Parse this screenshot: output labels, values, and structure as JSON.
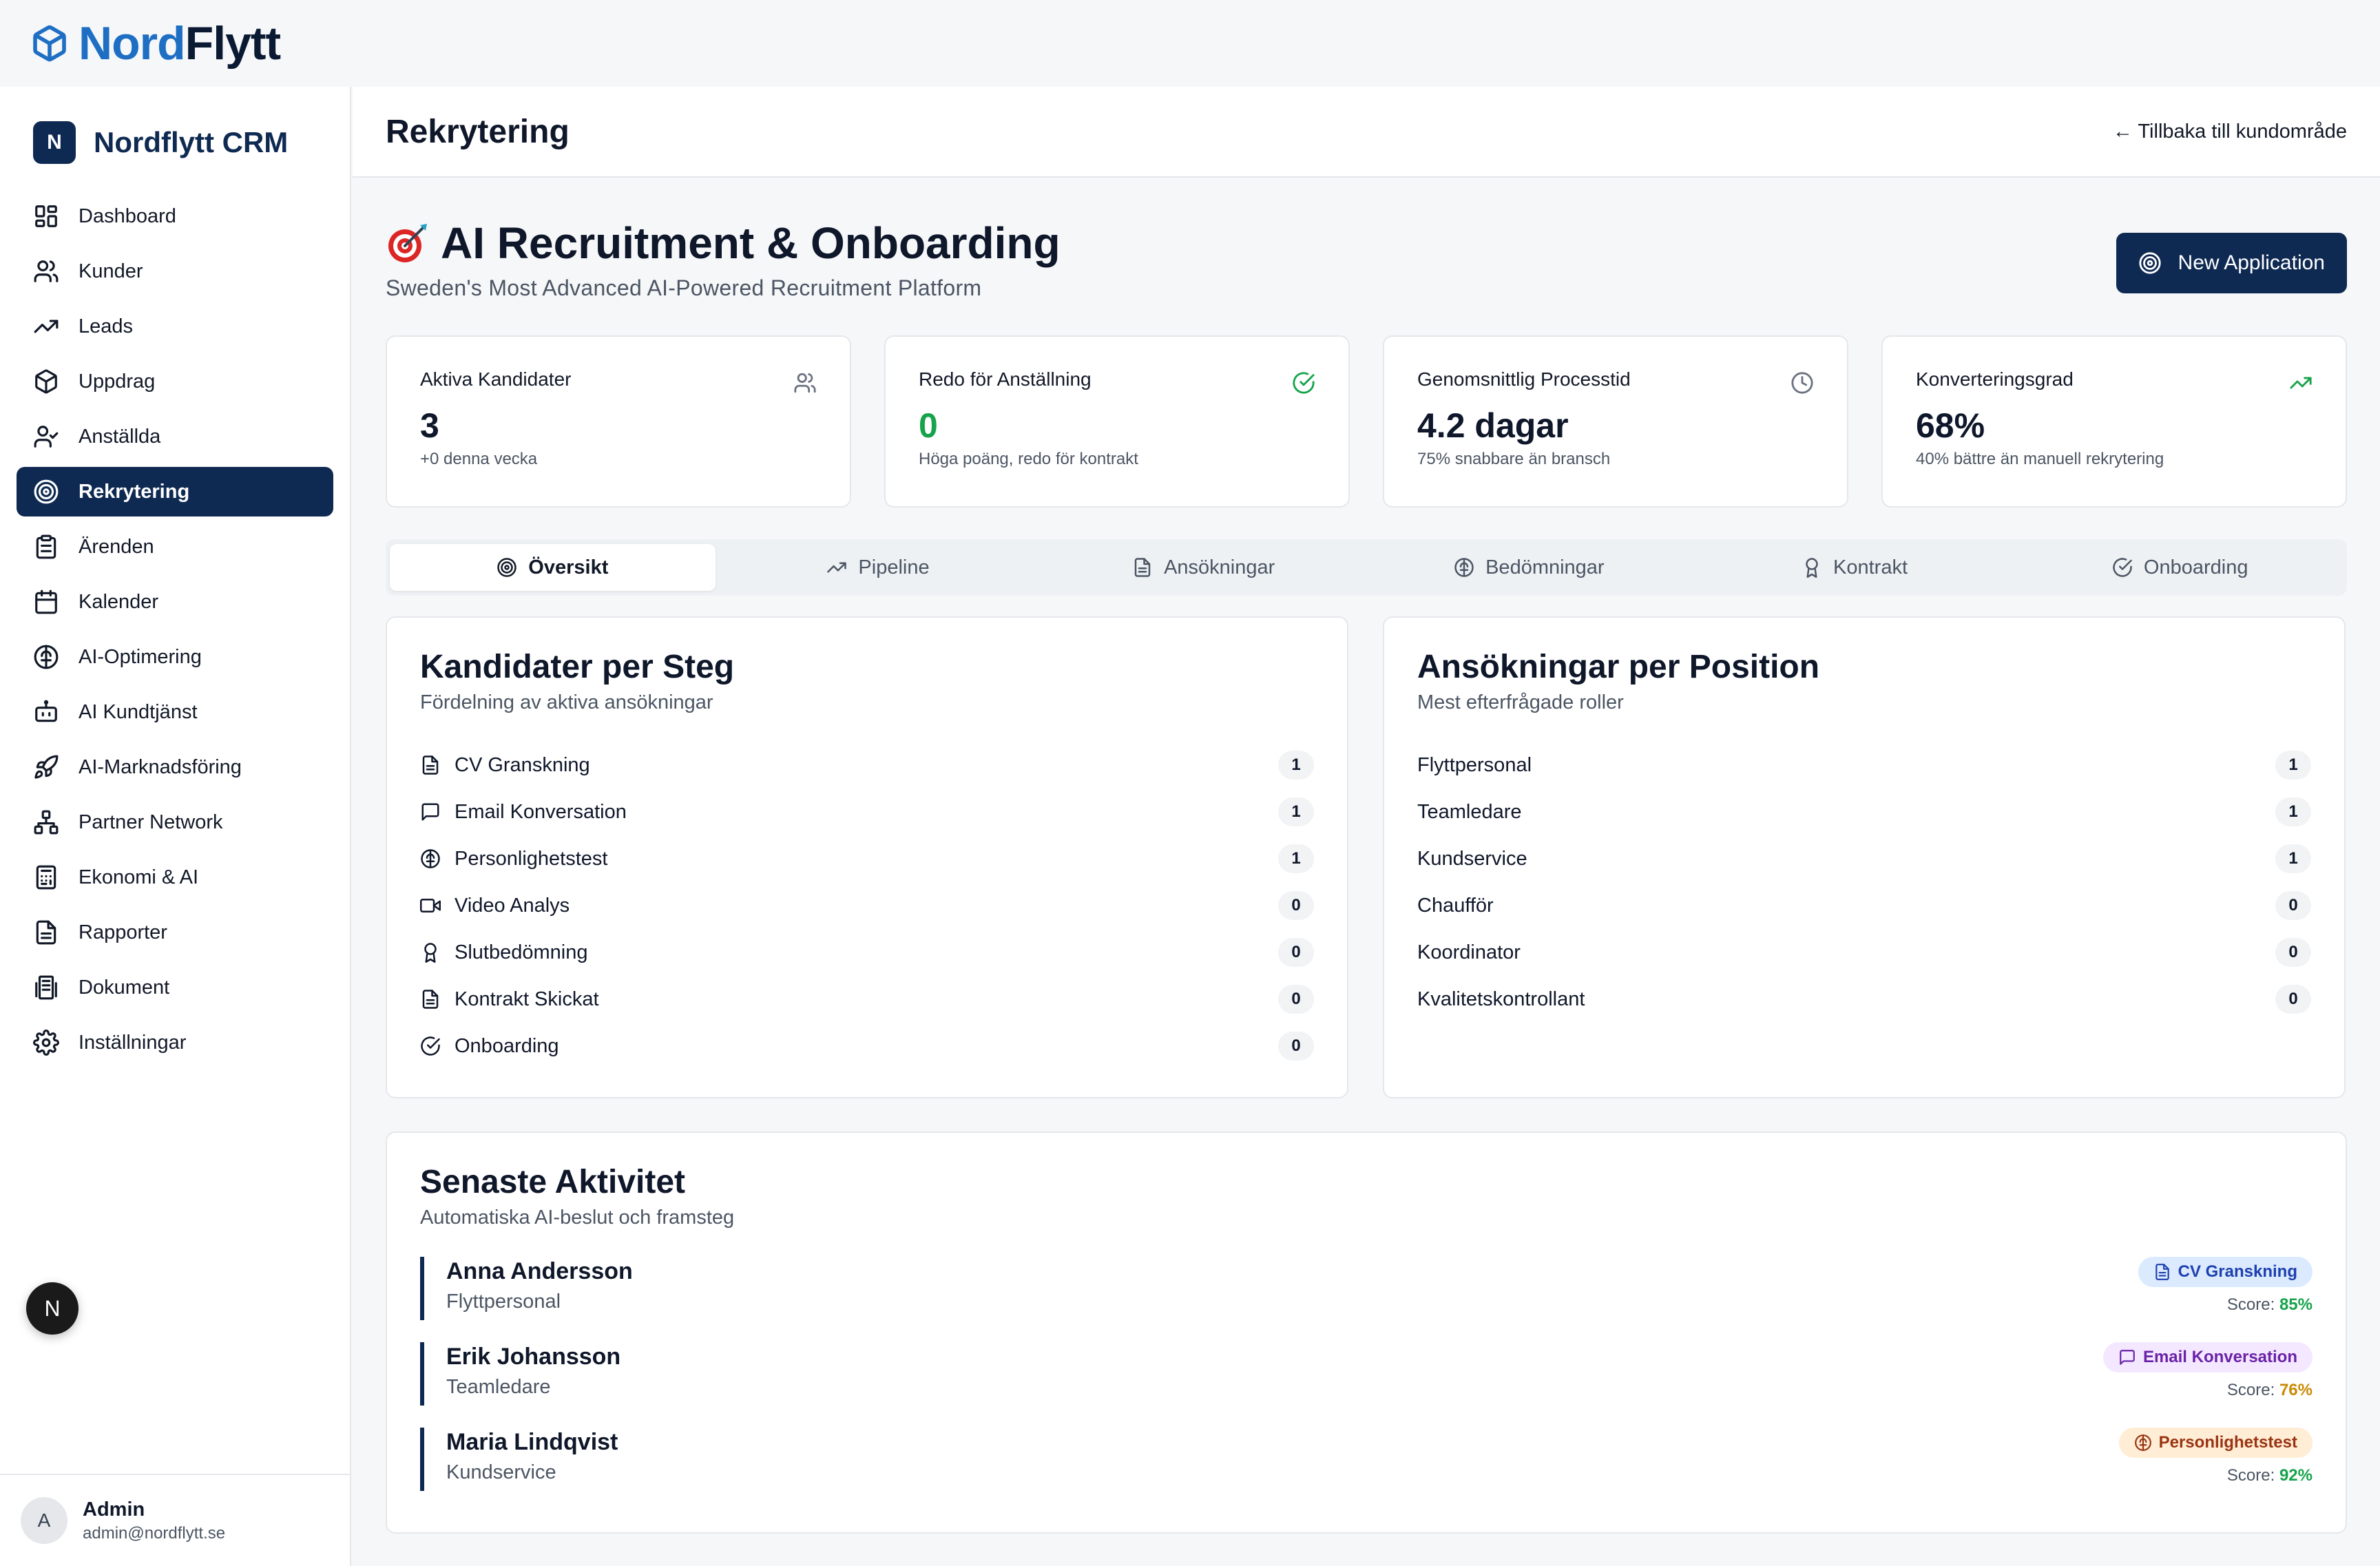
{
  "brand": {
    "part1": "Nord",
    "part2": "Flytt"
  },
  "sidebar": {
    "logo_letter": "N",
    "title": "Nordflytt CRM",
    "items": [
      {
        "label": "Dashboard",
        "icon": "dashboard-icon"
      },
      {
        "label": "Kunder",
        "icon": "users-icon"
      },
      {
        "label": "Leads",
        "icon": "trending-up-icon"
      },
      {
        "label": "Uppdrag",
        "icon": "package-icon"
      },
      {
        "label": "Anställda",
        "icon": "user-check-icon"
      },
      {
        "label": "Rekrytering",
        "icon": "target-icon",
        "active": true
      },
      {
        "label": "Ärenden",
        "icon": "clipboard-icon"
      },
      {
        "label": "Kalender",
        "icon": "calendar-icon"
      },
      {
        "label": "AI-Optimering",
        "icon": "brain-icon"
      },
      {
        "label": "AI Kundtjänst",
        "icon": "bot-icon"
      },
      {
        "label": "AI-Marknadsföring",
        "icon": "rocket-icon"
      },
      {
        "label": "Partner Network",
        "icon": "network-icon"
      },
      {
        "label": "Ekonomi & AI",
        "icon": "calculator-icon"
      },
      {
        "label": "Rapporter",
        "icon": "file-text-icon"
      },
      {
        "label": "Dokument",
        "icon": "documents-icon"
      },
      {
        "label": "Inställningar",
        "icon": "settings-icon"
      }
    ],
    "next_badge": "N",
    "user": {
      "avatar_letter": "A",
      "name": "Admin",
      "email": "admin@nordflytt.se"
    }
  },
  "topbar": {
    "title": "Rekrytering",
    "back_link": "← Tillbaka till kundområde"
  },
  "hero": {
    "title": "AI Recruitment & Onboarding",
    "subtitle": "Sweden's Most Advanced AI-Powered Recruitment Platform",
    "button": "New Application"
  },
  "stats": [
    {
      "label": "Aktiva Kandidater",
      "value": "3",
      "note": "+0 denna vecka",
      "icon": "users-icon"
    },
    {
      "label": "Redo för Anställning",
      "value": "0",
      "note": "Höga poäng, redo för kontrakt",
      "icon": "check-circle-icon"
    },
    {
      "label": "Genomsnittlig Processtid",
      "value": "4.2 dagar",
      "note": "75% snabbare än bransch",
      "icon": "clock-icon"
    },
    {
      "label": "Konverteringsgrad",
      "value": "68%",
      "note": "40% bättre än manuell rekrytering",
      "icon": "trending-up-icon"
    }
  ],
  "tabs": [
    {
      "label": "Översikt",
      "icon": "target-icon",
      "active": true
    },
    {
      "label": "Pipeline",
      "icon": "trending-up-icon"
    },
    {
      "label": "Ansökningar",
      "icon": "file-text-icon"
    },
    {
      "label": "Bedömningar",
      "icon": "brain-icon"
    },
    {
      "label": "Kontrakt",
      "icon": "award-icon"
    },
    {
      "label": "Onboarding",
      "icon": "check-circle-icon"
    }
  ],
  "stages": {
    "title": "Kandidater per Steg",
    "subtitle": "Fördelning av aktiva ansökningar",
    "rows": [
      {
        "label": "CV Granskning",
        "count": "1",
        "icon": "file-text-icon"
      },
      {
        "label": "Email Konversation",
        "count": "1",
        "icon": "message-icon"
      },
      {
        "label": "Personlighetstest",
        "count": "1",
        "icon": "brain-icon"
      },
      {
        "label": "Video Analys",
        "count": "0",
        "icon": "video-icon"
      },
      {
        "label": "Slutbedömning",
        "count": "0",
        "icon": "award-icon"
      },
      {
        "label": "Kontrakt Skickat",
        "count": "0",
        "icon": "file-text-icon"
      },
      {
        "label": "Onboarding",
        "count": "0",
        "icon": "check-circle-icon"
      }
    ]
  },
  "positions": {
    "title": "Ansökningar per Position",
    "subtitle": "Mest efterfrågade roller",
    "rows": [
      {
        "label": "Flyttpersonal",
        "count": "1"
      },
      {
        "label": "Teamledare",
        "count": "1"
      },
      {
        "label": "Kundservice",
        "count": "1"
      },
      {
        "label": "Chaufför",
        "count": "0"
      },
      {
        "label": "Koordinator",
        "count": "0"
      },
      {
        "label": "Kvalitetskontrollant",
        "count": "0"
      }
    ]
  },
  "activity": {
    "title": "Senaste Aktivitet",
    "subtitle": "Automatiska AI-beslut och framsteg",
    "items": [
      {
        "name": "Anna Andersson",
        "role": "Flyttpersonal",
        "stage": "CV Granskning",
        "score_label": "Score:",
        "score": "85%",
        "color": "blue"
      },
      {
        "name": "Erik Johansson",
        "role": "Teamledare",
        "stage": "Email Konversation",
        "score_label": "Score:",
        "score": "76%",
        "color": "purple"
      },
      {
        "name": "Maria Lindqvist",
        "role": "Kundservice",
        "stage": "Personlighetstest",
        "score_label": "Score:",
        "score": "92%",
        "color": "orange"
      }
    ]
  },
  "colors": {
    "primary": "#0f2a52",
    "brand_blue": "#1e6fc4",
    "green": "#16a34a",
    "amber": "#ca8a04"
  }
}
